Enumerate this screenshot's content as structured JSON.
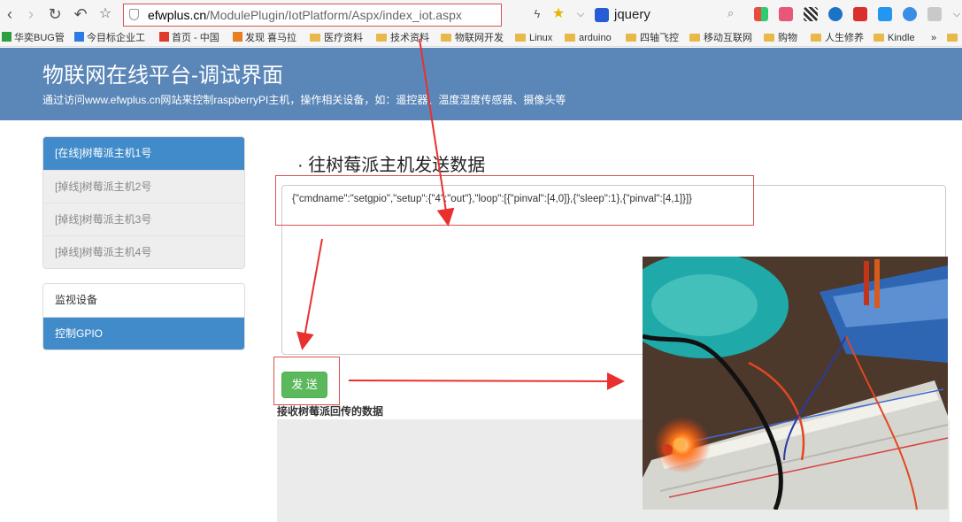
{
  "browser": {
    "url_host": "efwplus.cn",
    "url_path": "/ModulePlugin/IotPlatform/Aspx/index_iot.aspx",
    "search_value": "jquery",
    "bookmarks": [
      "华奕BUG管",
      "今目标企业工",
      "首页 - 中国",
      "发现 喜马拉",
      "医疗资料",
      "技术资料",
      "物联网开发",
      "Linux",
      "arduino",
      "四轴飞控",
      "移动互联网",
      "购物",
      "人生修养",
      "Kindle"
    ],
    "more_label": "»"
  },
  "header": {
    "title": "物联网在线平台-调试界面",
    "subtitle": "通过访问www.efwplus.cn网站来控制raspberryPI主机，操作相关设备，如：遥控器、温度湿度传感器、摄像头等"
  },
  "sidebar": {
    "hosts": [
      {
        "label": "[在线]树莓派主机1号",
        "status": "online"
      },
      {
        "label": "[掉线]树莓派主机2号",
        "status": "offline"
      },
      {
        "label": "[掉线]树莓派主机3号",
        "status": "offline"
      },
      {
        "label": "[掉线]树莓派主机4号",
        "status": "offline"
      }
    ],
    "functions": [
      {
        "label": "监视设备",
        "active": false
      },
      {
        "label": "控制GPIO",
        "active": true
      }
    ]
  },
  "main": {
    "section_title": "往树莓派主机发送数据",
    "command_text": "{\"cmdname\":\"setgpio\",\"setup\":{\"4\":\"out\"},\"loop\":[{\"pinval\":[4,0]},{\"sleep\":1},{\"pinval\":[4,1]}]}",
    "send_label": "发 送",
    "receive_label": "接收树莓派回传的数据"
  },
  "colors": {
    "banner": "#5a86b8",
    "active_item": "#428bca",
    "send_button": "#5cb85c",
    "annotation": "#e8312f"
  }
}
